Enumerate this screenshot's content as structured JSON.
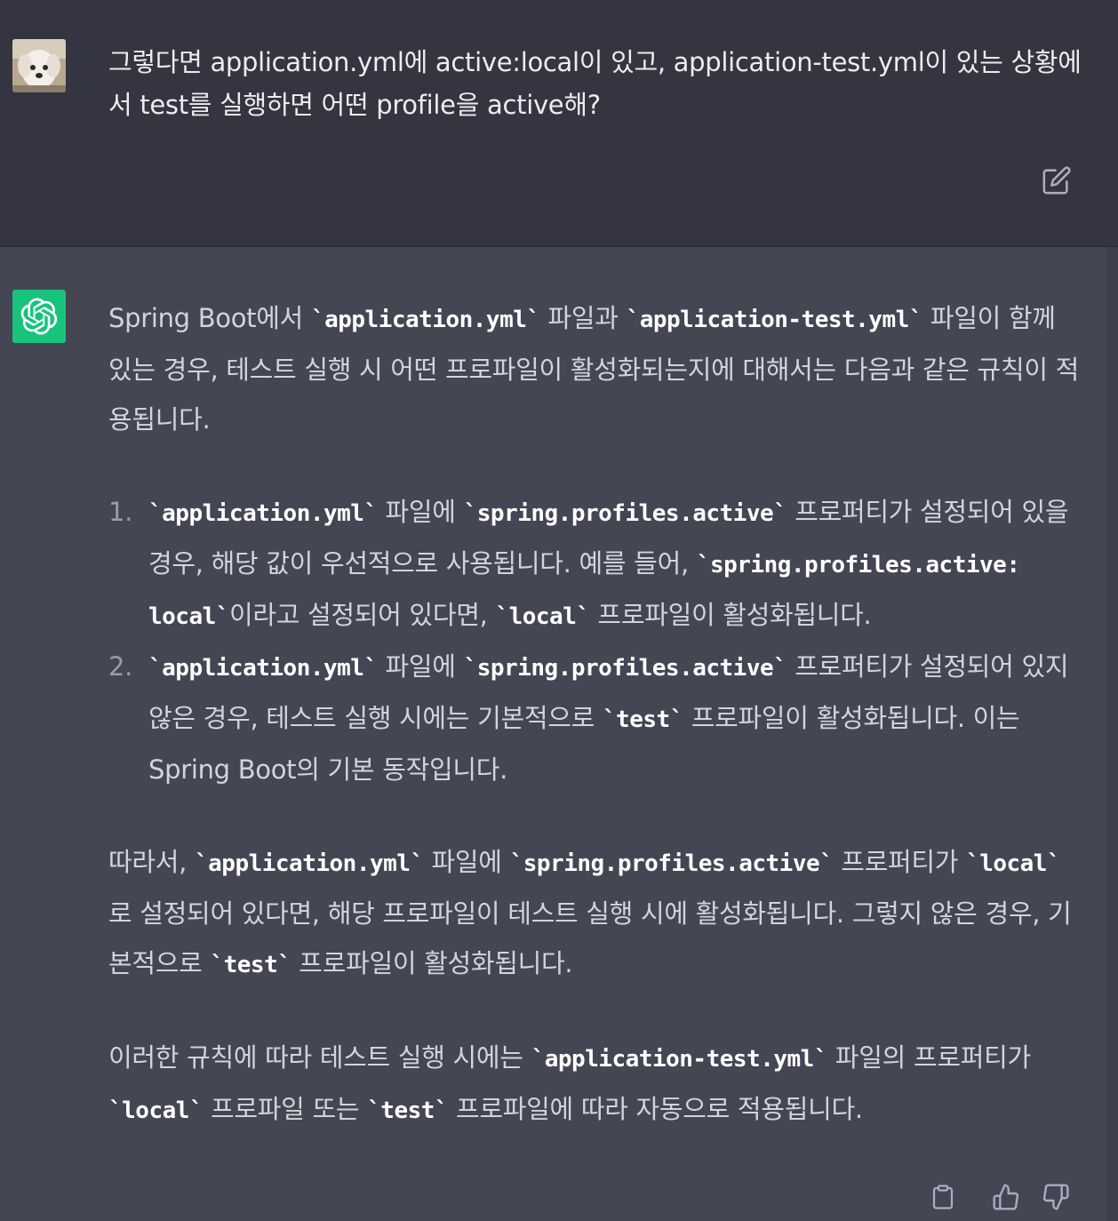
{
  "user_message": {
    "text": "그렇다면 application.yml에 active:local이 있고, application-test.yml이 있는 상황에서 test를 실행하면 어떤 profile을 active해?"
  },
  "assistant_message": {
    "intro": {
      "t1": "Spring Boot에서 ",
      "c1": "application.yml",
      "t2": " 파일과 ",
      "c2": "application-test.yml",
      "t3": " 파일이 함께 있는 경우, 테스트 실행 시 어떤 프로파일이 활성화되는지에 대해서는 다음과 같은 규칙이 적용됩니다."
    },
    "items": [
      {
        "num": "1.",
        "c1": "application.yml",
        "t1": " 파일에 ",
        "c2": "spring.profiles.active",
        "t2": " 프로퍼티가 설정되어 있을 경우, 해당 값이 우선적으로 사용됩니다. 예를 들어, ",
        "c3": "spring.profiles.active: local",
        "t3": "이라고 설정되어 있다면, ",
        "c4": "local",
        "t4": " 프로파일이 활성화됩니다."
      },
      {
        "num": "2.",
        "c1": "application.yml",
        "t1": " 파일에 ",
        "c2": "spring.profiles.active",
        "t2": " 프로퍼티가 설정되어 있지 않은 경우, 테스트 실행 시에는 기본적으로 ",
        "c3": "test",
        "t3": " 프로파일이 활성화됩니다. 이는 Spring Boot의 기본 동작입니다."
      }
    ],
    "para2": {
      "t1": "따라서, ",
      "c1": "application.yml",
      "t2": " 파일에 ",
      "c2": "spring.profiles.active",
      "t3": " 프로퍼티가 ",
      "c3": "local",
      "t4": "로 설정되어 있다면, 해당 프로파일이 테스트 실행 시에 활성화됩니다. 그렇지 않은 경우, 기본적으로 ",
      "c4": "test",
      "t5": " 프로파일이 활성화됩니다."
    },
    "para3": {
      "t1": "이러한 규칙에 따라 테스트 실행 시에는 ",
      "c1": "application-test.yml",
      "t2": " 파일의 프로퍼티가 ",
      "c2": "local",
      "t3": " 프로파일 또는 ",
      "c3": "test",
      "t4": " 프로파일에 따라 자동으로 적용됩니다."
    }
  },
  "icons": {
    "edit": "edit-icon",
    "copy": "clipboard-icon",
    "like": "thumbs-up-icon",
    "dislike": "thumbs-down-icon",
    "assistant_logo": "openai-logo-icon"
  },
  "colors": {
    "user_bg": "#343541",
    "assistant_bg": "#444654",
    "logo_bg": "#19c37d"
  }
}
